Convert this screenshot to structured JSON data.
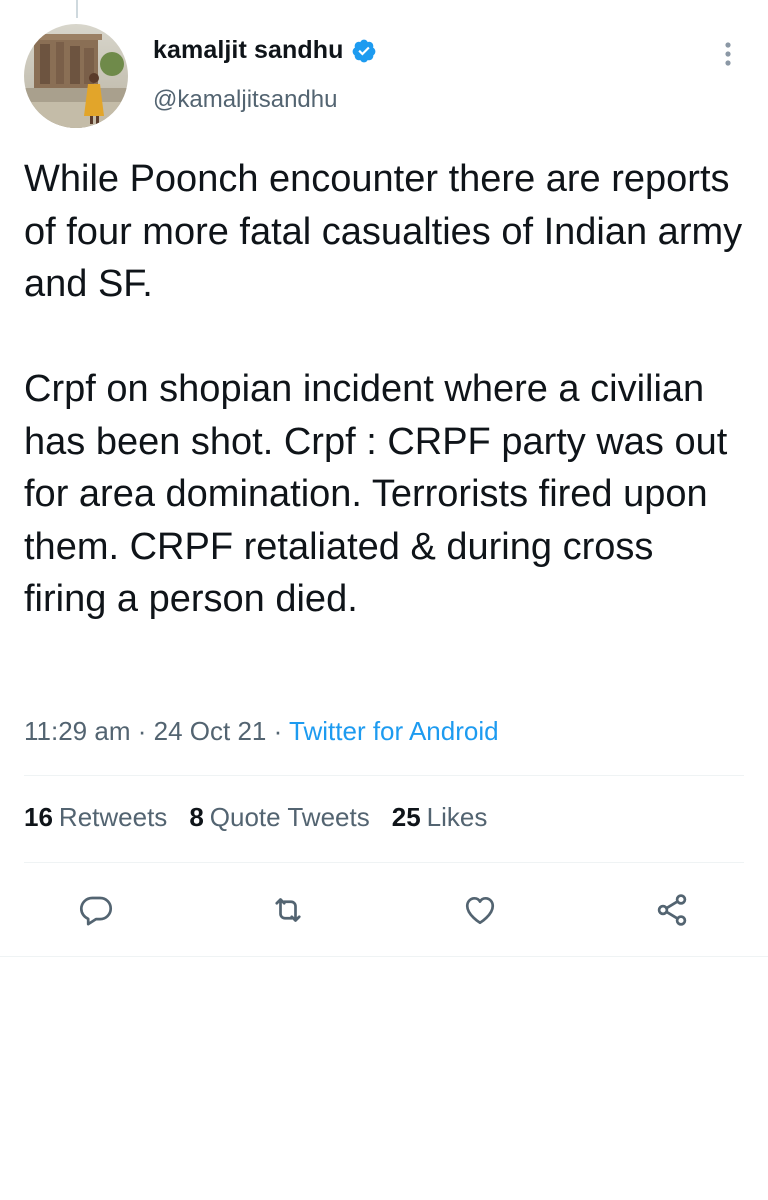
{
  "tweet": {
    "author": {
      "display_name": "kamaljit sandhu",
      "handle": "@kamaljitsandhu",
      "verified_icon": "verified-badge-icon",
      "avatar": "profile-photo"
    },
    "text": "While Poonch encounter there are reports of four more fatal casualties of Indian army and SF.\n\nCrpf on shopian incident where a civilian has been shot. Crpf : CRPF party was out for area domination. Terrorists fired upon them. CRPF retaliated & during cross firing a person died.",
    "time": "11:29 am",
    "separator": "·",
    "date": "24 Oct 21",
    "source": "Twitter for Android",
    "stats": {
      "retweets_count": "16",
      "retweets_label": "Retweets",
      "quotes_count": "8",
      "quotes_label": "Quote Tweets",
      "likes_count": "25",
      "likes_label": "Likes"
    },
    "actions": [
      "reply-icon",
      "retweet-icon",
      "like-icon",
      "share-icon"
    ]
  },
  "colors": {
    "text": "#0f1419",
    "secondary": "#536471",
    "link": "#1d9bf0",
    "divider": "#eff3f4"
  }
}
